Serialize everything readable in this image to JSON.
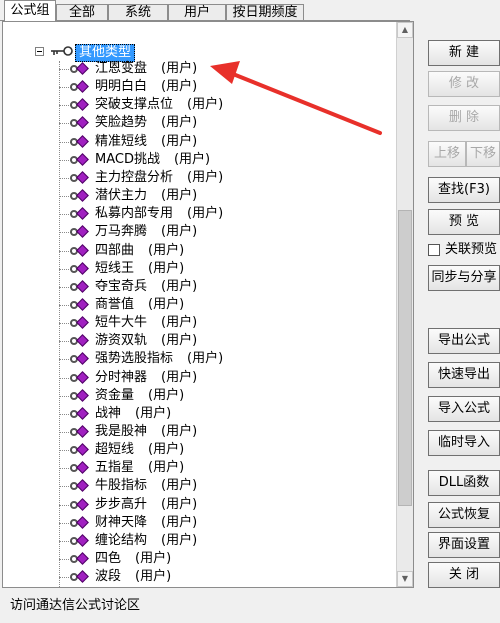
{
  "tabs": [
    "公式组",
    "全部",
    "系统",
    "用户",
    "按日期频度"
  ],
  "active_tab": 0,
  "tree": {
    "root_label": "其他类型",
    "user_tag": "(用户)",
    "items": [
      "江恩变盘",
      "明明白白",
      "突破支撑点位",
      "笑脸趋势",
      "精准短线",
      "MACD挑战",
      "主力控盘分析",
      "潜伏主力",
      "私募内部专用",
      "万马奔腾",
      "四部曲",
      "短线王",
      "夺宝奇兵",
      "商誉值",
      "短牛大牛",
      "游资双轨",
      "强势选股指标",
      "分时神器",
      "资金量",
      "战神",
      "我是股神",
      "超短线",
      "五指星",
      "牛股指标",
      "步步高升",
      "财神天降",
      "缠论结构",
      "四色",
      "波段"
    ]
  },
  "buttons": {
    "new": "新 建",
    "modify": "修 改",
    "delete": "删 除",
    "move_up": "上移",
    "move_down": "下移",
    "find": "查找(F3)",
    "preview": "预 览",
    "link_preview": "关联预览",
    "sync_share": "同步与分享",
    "export": "导出公式",
    "quick_export": "快速导出",
    "import": "导入公式",
    "temp_import": "临时导入",
    "dll": "DLL函数",
    "restore": "公式恢复",
    "ui_settings": "界面设置",
    "close": "关 闭"
  },
  "status_text": "访问通达信公式讨论区",
  "colors": {
    "selection": "#3399ff",
    "arrow": "#e8302a",
    "gem": "#a020c0"
  }
}
